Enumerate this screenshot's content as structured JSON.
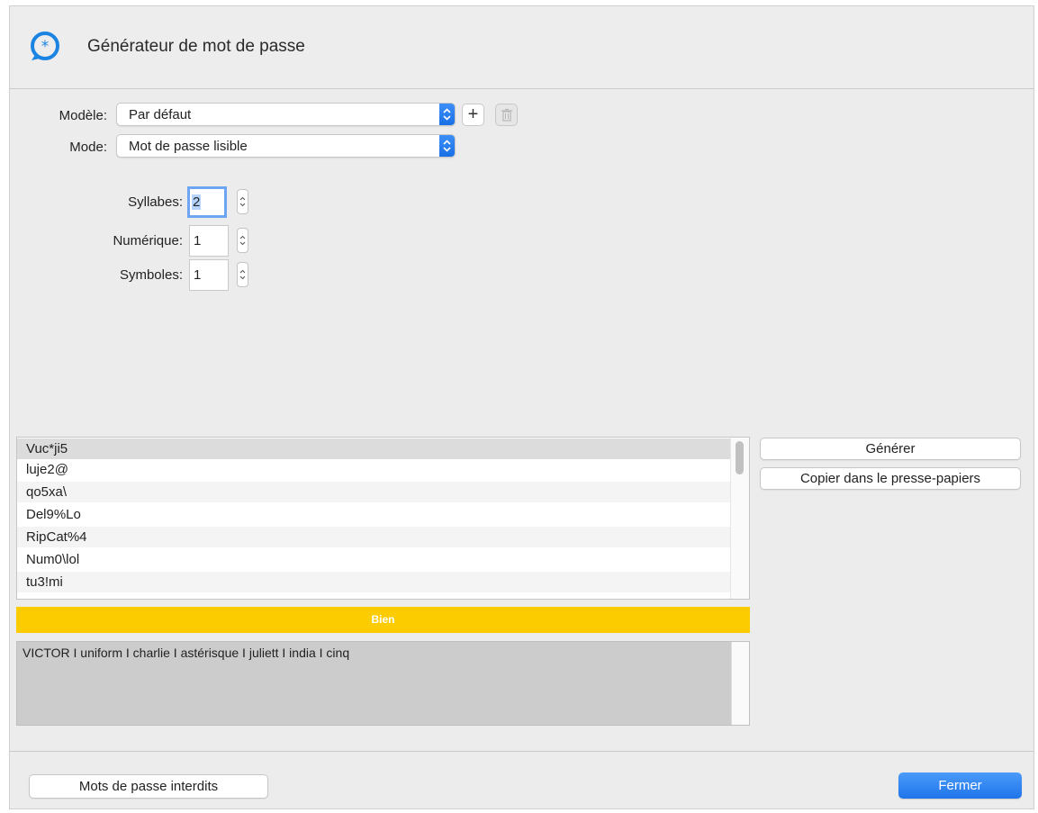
{
  "window": {
    "title": "Générateur de mot de passe",
    "icon": "password-generator-icon"
  },
  "form": {
    "model_label": "Modèle:",
    "model_value": "Par défaut",
    "add_icon": "plus-icon",
    "delete_icon": "trash-icon",
    "mode_label": "Mode:",
    "mode_value": "Mot de passe lisible",
    "syllables_label": "Syllabes:",
    "syllables_value": "2",
    "numeric_label": "Numérique:",
    "numeric_value": "1",
    "symbols_label": "Symboles:",
    "symbols_value": "1"
  },
  "passwords": [
    "Vuc*ji5",
    "luje2@",
    "qo5xa\\",
    "Del9%Lo",
    "RipCat%4",
    "Num0\\lol",
    "tu3!mi"
  ],
  "actions": {
    "generate_label": "Générer",
    "copy_label": "Copier dans le presse-papiers"
  },
  "strength": {
    "label": "Bien",
    "color": "#fdcc00"
  },
  "phonetic": "VICTOR I uniform I charlie I astérisque I juliett I india I cinq",
  "footer": {
    "forbidden_label": "Mots de passe interdits",
    "close_label": "Fermer"
  },
  "colors": {
    "accent": "#1f74ea",
    "strength_good": "#fdcc00"
  }
}
